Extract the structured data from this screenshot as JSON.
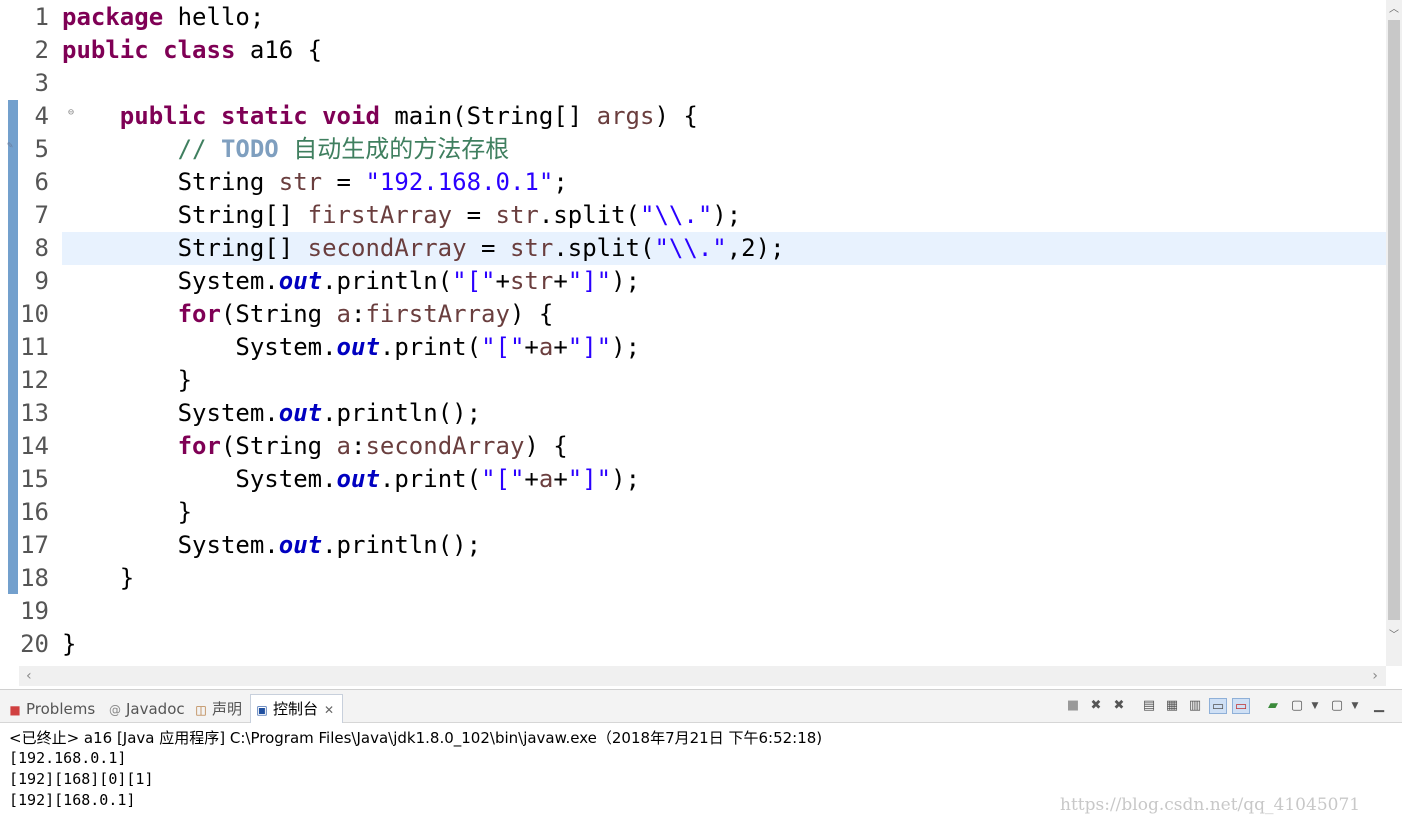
{
  "editor": {
    "line_numbers": [
      "1",
      "2",
      "3",
      "4",
      "5",
      "6",
      "7",
      "8",
      "9",
      "10",
      "11",
      "12",
      "13",
      "14",
      "15",
      "16",
      "17",
      "18",
      "19",
      "20"
    ],
    "code": {
      "l1_kw": "package",
      "l1_rest": " hello;",
      "l2_kw1": "public",
      "l2_kw2": "class",
      "l2_rest": " a16 {",
      "l4_indent": "    ",
      "l4_kw1": "public",
      "l4_kw2": "static",
      "l4_kw3": "void",
      "l4_a": " main(String[] ",
      "l4_var": "args",
      "l4_b": ") {",
      "l5_indent": "        ",
      "l5_cm": "// ",
      "l5_todo": "TODO",
      "l5_text": " 自动生成的方法存根",
      "l6_a": "        String ",
      "l6_var": "str",
      "l6_b": " = ",
      "l6_str": "\"192.168.0.1\"",
      "l6_c": ";",
      "l7_a": "        String[] ",
      "l7_var": "firstArray",
      "l7_b": " = ",
      "l7_var2": "str",
      "l7_c": ".split(",
      "l7_str": "\"\\\\.\"",
      "l7_d": ");",
      "l8_a": "        String[] ",
      "l8_var": "secondArray",
      "l8_b": " = ",
      "l8_var2": "str",
      "l8_c": ".split(",
      "l8_str": "\"\\\\.\"",
      "l8_d": ",2);",
      "l9_a": "        System.",
      "l9_fld": "out",
      "l9_b": ".println(",
      "l9_s1": "\"[\"",
      "l9_c": "+",
      "l9_var": "str",
      "l9_d": "+",
      "l9_s2": "\"]\"",
      "l9_e": ");",
      "l10_indent": "        ",
      "l10_kw": "for",
      "l10_a": "(String ",
      "l10_var": "a",
      "l10_b": ":",
      "l10_var2": "firstArray",
      "l10_c": ") {",
      "l11_a": "            System.",
      "l11_fld": "out",
      "l11_b": ".print(",
      "l11_s1": "\"[\"",
      "l11_c": "+",
      "l11_var": "a",
      "l11_d": "+",
      "l11_s2": "\"]\"",
      "l11_e": ");",
      "l12": "        }",
      "l13_a": "        System.",
      "l13_fld": "out",
      "l13_b": ".println();",
      "l14_indent": "        ",
      "l14_kw": "for",
      "l14_a": "(String ",
      "l14_var": "a",
      "l14_b": ":",
      "l14_var2": "secondArray",
      "l14_c": ") {",
      "l15_a": "            System.",
      "l15_fld": "out",
      "l15_b": ".print(",
      "l15_s1": "\"[\"",
      "l15_c": "+",
      "l15_var": "a",
      "l15_d": "+",
      "l15_s2": "\"]\"",
      "l15_e": ");",
      "l16": "        }",
      "l17_a": "        System.",
      "l17_fld": "out",
      "l17_b": ".println();",
      "l18": "    }",
      "l20": "}"
    }
  },
  "view": {
    "tabs": {
      "problems": "Problems",
      "javadoc": "Javadoc",
      "declaration": "声明",
      "console": "控制台"
    },
    "console_header": "<已终止> a16 [Java 应用程序] C:\\Program Files\\Java\\jdk1.8.0_102\\bin\\javaw.exe（2018年7月21日 下午6:52:18)",
    "output": [
      "[192.168.0.1]",
      "[192][168][0][1]",
      "[192][168.0.1]"
    ]
  },
  "watermark": "https://blog.csdn.net/qq_41045071",
  "icons": {
    "problems": "problems-icon",
    "javadoc": "javadoc-icon",
    "declaration": "declaration-icon",
    "console": "console-icon"
  },
  "colors": {
    "keyword": "#7f0055",
    "string": "#2a00ff",
    "comment": "#3f7f5f",
    "field": "#0000c0",
    "current_line": "#e8f2fe"
  }
}
